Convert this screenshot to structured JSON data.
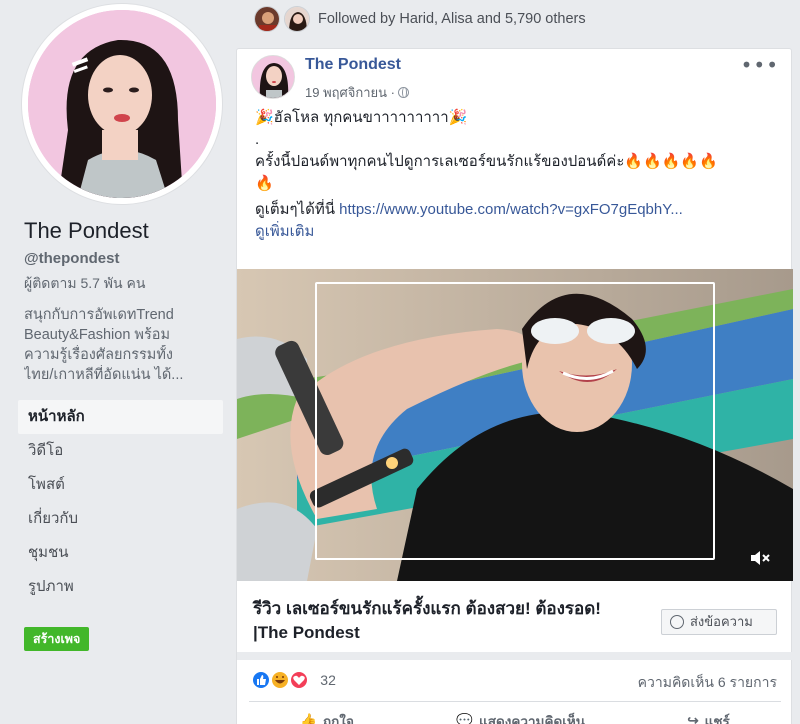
{
  "sidebar": {
    "page_name": "The Pondest",
    "handle": "@thepondest",
    "followers": "ผู้ติดตาม 5.7 พัน คน",
    "about_lines": [
      "สนุกกับการอัพเดทTrend",
      "Beauty&Fashion พร้อม",
      "ความรู้เรื่องศัลยกรรมทั้ง",
      "ไทย/เกาหลีที่อัดแน่น ได้..."
    ],
    "nav": [
      {
        "label": "หน้าหลัก"
      },
      {
        "label": "วิดีโอ"
      },
      {
        "label": "โพสต์"
      },
      {
        "label": "เกี่ยวกับ"
      },
      {
        "label": "ชุมชน"
      },
      {
        "label": "รูปภาพ"
      }
    ],
    "create_page_label": "สร้างเพจ"
  },
  "top_strip": {
    "followed_text": "Followed by Harid, Alisa and 5,790 others"
  },
  "post": {
    "author": "The Pondest",
    "date": "19 พฤศจิกายน ·",
    "more_label": "•••",
    "text_line1": "🎉ฮัลโหล ทุกคนขาาาาาาาาา🎉",
    "text_line2": ".",
    "text_line3": "ครั้งนี้ปอนด์พาทุกคนไปดูการเลเซอร์ขนรักแร้ของปอนด์ค่ะ🔥🔥🔥🔥🔥",
    "text_line4": "🔥",
    "text_line5_prefix": "ดูเต็มๆได้ที่นี่ ",
    "link": "https://www.youtube.com/watch?v=gxFO7gEqbhY...",
    "see_more": "ดูเพิ่มเติม",
    "link_title": "รีวิว เลเซอร์ขนรักแร้ครั้งแรก ต้องสวย! ต้องรอด! |The Pondest",
    "message_button": "ส่งข้อความ",
    "reaction_count": "32",
    "comments": "ความคิดเห็น 6 รายการ",
    "actions": [
      {
        "label": "ถูกใจ"
      },
      {
        "label": "แสดงความคิดเห็น"
      },
      {
        "label": "แชร์"
      }
    ]
  },
  "colors": {
    "link_blue": "#385898",
    "green": "#42b72a",
    "background": "#e9ebee"
  }
}
